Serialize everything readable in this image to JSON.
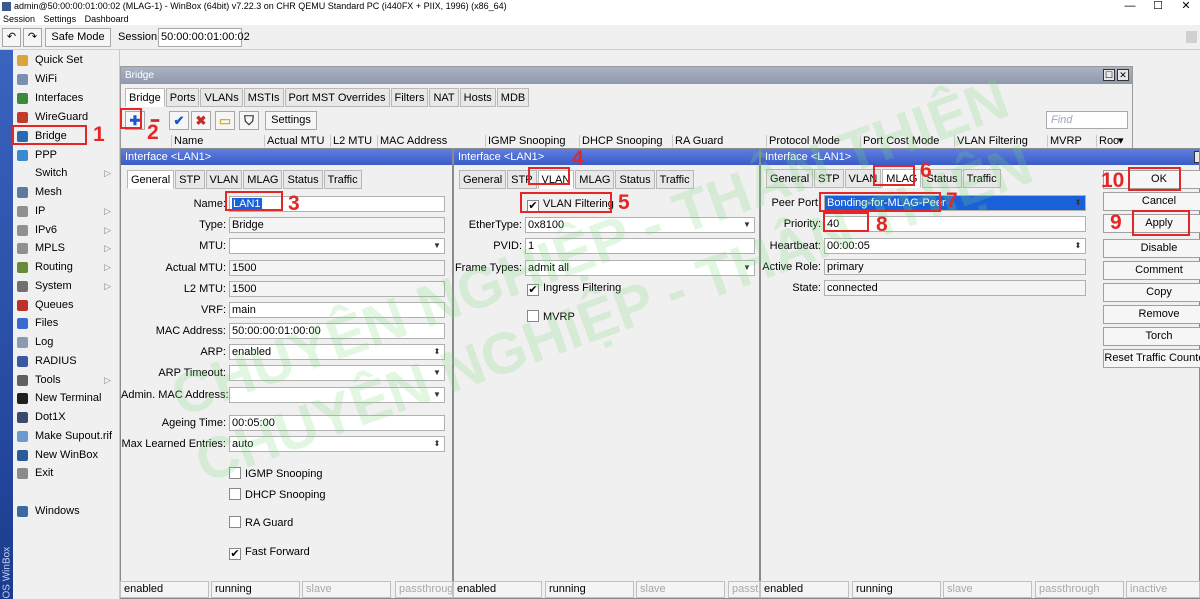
{
  "window": {
    "title": "admin@50:00:00:01:00:02 (MLAG-1) - WinBox (64bit) v7.22.3 on CHR QEMU Standard PC (i440FX + PIIX, 1996) (x86_64)",
    "controls": [
      "—",
      "☐",
      "✕"
    ]
  },
  "menu": [
    "Session",
    "Settings",
    "Dashboard"
  ],
  "toolbar": {
    "undo_label": "↶",
    "redo_label": "↷",
    "safe_mode_label": "Safe Mode",
    "session_label": "Session:",
    "session_value": "50:00:00:01:00:02"
  },
  "sidebar": {
    "brand": "OS WinBox",
    "items": [
      {
        "label": "Quick Set",
        "color": "#d9a43a"
      },
      {
        "label": "WiFi",
        "color": "#7a8fb0"
      },
      {
        "label": "Interfaces",
        "color": "#3a8a3a"
      },
      {
        "label": "WireGuard",
        "color": "#c23a2a"
      },
      {
        "label": "Bridge",
        "color": "#2a6ab0"
      },
      {
        "label": "PPP",
        "color": "#3a8ad0"
      },
      {
        "label": "Switch",
        "color": "#f0f0f0"
      },
      {
        "label": "Mesh",
        "color": "#5a7aa0"
      },
      {
        "label": "IP",
        "color": "#909090"
      },
      {
        "label": "IPv6",
        "color": "#909090"
      },
      {
        "label": "MPLS",
        "color": "#909090"
      },
      {
        "label": "Routing",
        "color": "#6a8a3a"
      },
      {
        "label": "System",
        "color": "#707070"
      },
      {
        "label": "Queues",
        "color": "#c0302a"
      },
      {
        "label": "Files",
        "color": "#3a6ad0"
      },
      {
        "label": "Log",
        "color": "#8a9ab0"
      },
      {
        "label": "RADIUS",
        "color": "#3a5aa0"
      },
      {
        "label": "Tools",
        "color": "#606060"
      },
      {
        "label": "New Terminal",
        "color": "#202020"
      },
      {
        "label": "Dot1X",
        "color": "#3a4a6a"
      },
      {
        "label": "Make Supout.rif",
        "color": "#6a9ad0"
      },
      {
        "label": "New WinBox",
        "color": "#2a5a9a"
      },
      {
        "label": "Exit",
        "color": "#8a8a8a"
      },
      {
        "label": "Windows",
        "color": "#3a6aa0"
      }
    ],
    "submenu_marker": "▷"
  },
  "bridge_window": {
    "title": "Bridge",
    "tabs": [
      "Bridge",
      "Ports",
      "VLANs",
      "MSTIs",
      "Port MST Overrides",
      "Filters",
      "NAT",
      "Hosts",
      "MDB"
    ],
    "add_icon": "✚",
    "remove_icon": "━",
    "enable_icon": "✔",
    "disable_icon": "✖",
    "comment_icon": "▭",
    "filter_icon": "⛉",
    "settings_label": "Settings",
    "find_placeholder": "Find",
    "columns": [
      "Name",
      "Actual MTU",
      "L2 MTU",
      "MAC Address",
      "IGMP Snooping",
      "DHCP Snooping",
      "RA Guard",
      "Protocol Mode",
      "Port Cost Mode",
      "VLAN Filtering",
      "MVRP",
      "Roo"
    ],
    "col_menu": "▾"
  },
  "panel_general": {
    "title": "Interface <LAN1>",
    "tabs": [
      "General",
      "STP",
      "VLAN",
      "MLAG",
      "Status",
      "Traffic"
    ],
    "fields": {
      "name": {
        "label": "Name:",
        "value": "LAN1"
      },
      "type": {
        "label": "Type:",
        "value": "Bridge"
      },
      "mtu": {
        "label": "MTU:",
        "value": ""
      },
      "actual_mtu": {
        "label": "Actual MTU:",
        "value": "1500"
      },
      "l2_mtu": {
        "label": "L2 MTU:",
        "value": "1500"
      },
      "vrf": {
        "label": "VRF:",
        "value": "main"
      },
      "mac": {
        "label": "MAC Address:",
        "value": "50:00:00:01:00:00"
      },
      "arp": {
        "label": "ARP:",
        "value": "enabled"
      },
      "arp_timeout": {
        "label": "ARP Timeout:",
        "value": ""
      },
      "admin_mac": {
        "label": "Admin. MAC Address:",
        "value": ""
      },
      "ageing": {
        "label": "Ageing Time:",
        "value": "00:05:00"
      },
      "max_learned": {
        "label": "Max Learned Entries:",
        "value": "auto"
      }
    },
    "checkboxes": {
      "igmp": {
        "label": "IGMP Snooping",
        "checked": false
      },
      "dhcp": {
        "label": "DHCP Snooping",
        "checked": false
      },
      "ra": {
        "label": "RA Guard",
        "checked": false
      },
      "ff": {
        "label": "Fast Forward",
        "checked": true
      }
    },
    "status": [
      "enabled",
      "running",
      "slave",
      "passthrough"
    ]
  },
  "panel_vlan": {
    "title": "Interface <LAN1>",
    "tabs": [
      "General",
      "STP",
      "VLAN",
      "MLAG",
      "Status",
      "Traffic"
    ],
    "checkboxes": {
      "vlan_filtering": {
        "label": "VLAN Filtering",
        "checked": true
      },
      "ingress": {
        "label": "Ingress Filtering",
        "checked": true
      },
      "mvrp": {
        "label": "MVRP",
        "checked": false
      }
    },
    "fields": {
      "ethertype": {
        "label": "EtherType:",
        "value": "0x8100"
      },
      "pvid": {
        "label": "PVID:",
        "value": "1"
      },
      "frame_types": {
        "label": "Frame Types:",
        "value": "admit all"
      }
    },
    "status": [
      "enabled",
      "running",
      "slave",
      "passthrough"
    ]
  },
  "panel_mlag": {
    "title": "Interface <LAN1>",
    "tabs": [
      "General",
      "STP",
      "VLAN",
      "MLAG",
      "Status",
      "Traffic"
    ],
    "fields": {
      "peer_port": {
        "label": "Peer Port:",
        "value": "Bonding-for-MLAG-Peer"
      },
      "priority": {
        "label": "Priority:",
        "value": "40"
      },
      "heartbeat": {
        "label": "Heartbeat:",
        "value": "00:00:05"
      },
      "active_role": {
        "label": "Active Role:",
        "value": "primary"
      },
      "state": {
        "label": "State:",
        "value": "connected"
      }
    },
    "status": [
      "enabled",
      "running",
      "slave",
      "passthrough",
      "inactive"
    ]
  },
  "actions": [
    "OK",
    "Cancel",
    "Apply",
    "Disable",
    "Comment",
    "Copy",
    "Remove",
    "Torch",
    "Reset Traffic Counters"
  ],
  "annotations": [
    "1",
    "2",
    "3",
    "4",
    "5",
    "6",
    "7",
    "8",
    "9",
    "10"
  ],
  "dropdown_icon": "▼",
  "dropdown_updown_icon": "⬍",
  "checkmark": "✔",
  "watermark": [
    "CHUYÊN NGHIỆP - THÂN THIỆN",
    "CHUYÊN NGHIỆP - THÂN THIỆN"
  ]
}
